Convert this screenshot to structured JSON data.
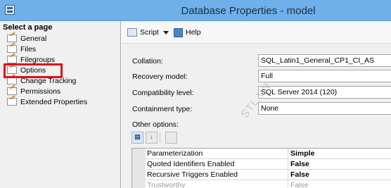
{
  "window": {
    "title": "Database Properties - model"
  },
  "left_pane": {
    "header": "Select a page",
    "items": [
      {
        "label": "General"
      },
      {
        "label": "Files"
      },
      {
        "label": "Filegroups"
      },
      {
        "label": "Options",
        "selected": true
      },
      {
        "label": "Change Tracking"
      },
      {
        "label": "Permissions"
      },
      {
        "label": "Extended Properties"
      }
    ],
    "highlight_color": "#e0111b"
  },
  "toolbar": {
    "script_label": "Script",
    "help_label": "Help"
  },
  "properties": {
    "collation_label": "Collation:",
    "collation_value": "SQL_Latin1_General_CP1_CI_AS",
    "recovery_label": "Recovery model:",
    "recovery_value": "Full",
    "compat_label": "Compatibility level:",
    "compat_value": "SQL Server 2014 (120)",
    "containment_label": "Containment type:",
    "containment_value": "None",
    "other_options_label": "Other options:"
  },
  "grid": {
    "rows": [
      {
        "name": "Parameterization",
        "value": "Simple"
      },
      {
        "name": "Quoted Identifiers Enabled",
        "value": "False"
      },
      {
        "name": "Recursive Triggers Enabled",
        "value": "False"
      },
      {
        "name": "Trustworthy",
        "value": "False"
      }
    ]
  },
  "watermark": "STL.VN",
  "colors": {
    "title_bar": "#6fb0ea",
    "pane_bg": "#f0f0f0"
  },
  "icons": [
    "database-window-icon",
    "page-icon",
    "script-icon",
    "dropdown-arrow-icon",
    "help-icon",
    "categorized-icon",
    "alphabetical-icon",
    "property-pages-icon"
  ]
}
